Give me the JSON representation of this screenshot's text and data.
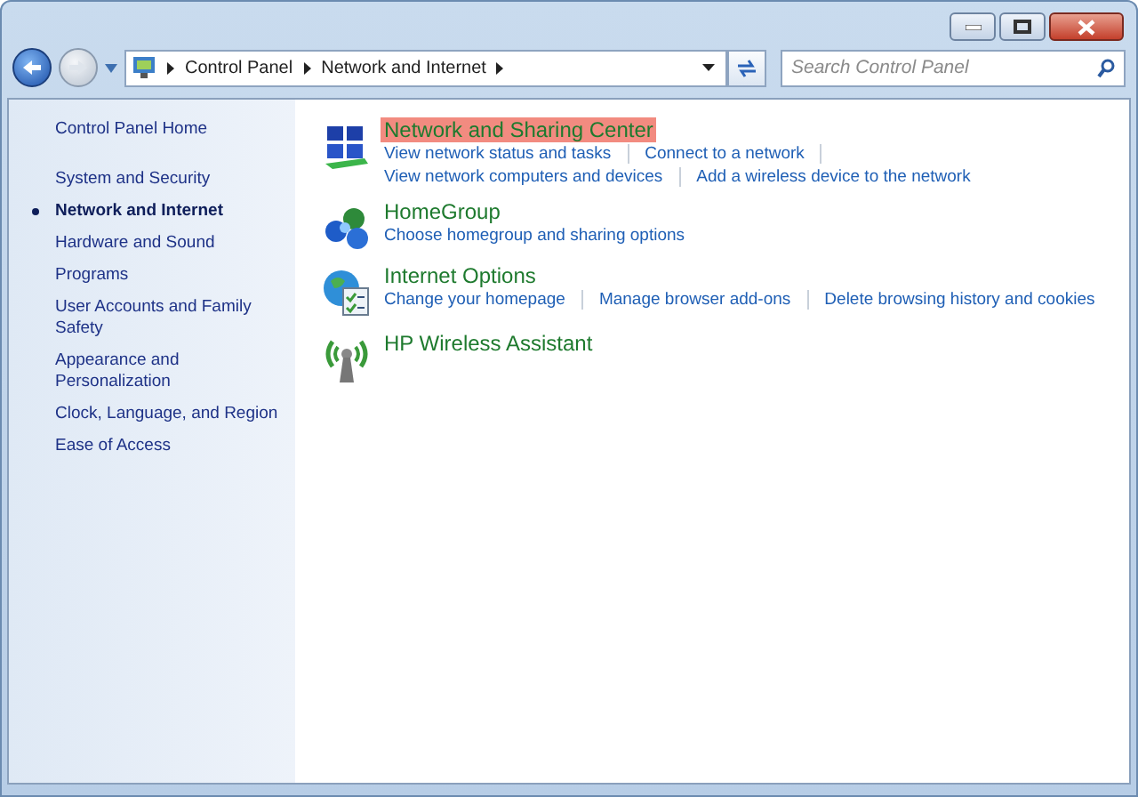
{
  "address_bar": {
    "crumbs": [
      "Control Panel",
      "Network and Internet"
    ]
  },
  "search": {
    "placeholder": "Search Control Panel"
  },
  "sidebar": {
    "home": "Control Panel Home",
    "items": [
      {
        "label": "System and Security",
        "selected": false
      },
      {
        "label": "Network and Internet",
        "selected": true
      },
      {
        "label": "Hardware and Sound",
        "selected": false
      },
      {
        "label": "Programs",
        "selected": false
      },
      {
        "label": "User Accounts and Family Safety",
        "selected": false
      },
      {
        "label": "Appearance and Personalization",
        "selected": false
      },
      {
        "label": "Clock, Language, and Region",
        "selected": false
      },
      {
        "label": "Ease of Access",
        "selected": false
      }
    ]
  },
  "categories": [
    {
      "kind": "network",
      "title": "Network and Sharing Center",
      "highlighted": true,
      "link_lines": [
        [
          "View network status and tasks",
          "Connect to a network"
        ],
        [
          "View network computers and devices",
          "Add a wireless device to the network"
        ]
      ]
    },
    {
      "kind": "homegroup",
      "title": "HomeGroup",
      "highlighted": false,
      "link_lines": [
        [
          "Choose homegroup and sharing options"
        ]
      ]
    },
    {
      "kind": "internet",
      "title": "Internet Options",
      "highlighted": false,
      "link_lines": [
        [
          "Change your homepage",
          "Manage browser add-ons",
          "Delete browsing history and cookies"
        ]
      ]
    },
    {
      "kind": "wireless",
      "title": "HP Wireless Assistant",
      "highlighted": false
    }
  ]
}
